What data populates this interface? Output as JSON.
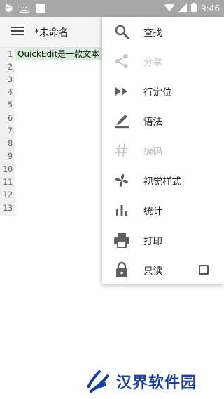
{
  "status_bar": {
    "time": "9:46",
    "icons": [
      "app-icon",
      "keyboard-icon",
      "square-icon",
      "wifi-icon",
      "signal-icon",
      "battery-icon"
    ]
  },
  "app_bar": {
    "menu_icon": "hamburger-icon",
    "title": "*未命名"
  },
  "editor": {
    "line_numbers": [
      "1",
      "2",
      "3",
      "4",
      "5",
      "6",
      "7",
      "8",
      "9",
      "10",
      "11",
      "12",
      "13"
    ],
    "first_line_text": "QuickEdit是一款文本"
  },
  "menu": {
    "items": [
      {
        "label": "查找",
        "icon": "search-icon",
        "enabled": true
      },
      {
        "label": "分享",
        "icon": "share-icon",
        "enabled": false
      },
      {
        "label": "行定位",
        "icon": "fast-forward-icon",
        "enabled": true
      },
      {
        "label": "语法",
        "icon": "pen-icon",
        "enabled": true
      },
      {
        "label": "编码",
        "icon": "hash-icon",
        "enabled": false
      },
      {
        "label": "视觉样式",
        "icon": "pinwheel-icon",
        "enabled": true
      },
      {
        "label": "统计",
        "icon": "bar-chart-icon",
        "enabled": true
      },
      {
        "label": "打印",
        "icon": "printer-icon",
        "enabled": true
      },
      {
        "label": "只读",
        "icon": "lock-icon",
        "enabled": true,
        "checkbox": false
      }
    ]
  },
  "watermark": {
    "text": "汉界软件园"
  },
  "colors": {
    "status_bar": "#a8a8a8",
    "line_highlight": "#d7ecd9",
    "icon": "#5f5f5f",
    "disabled": "#c2c2c2",
    "watermark": "#1d3f9c"
  }
}
